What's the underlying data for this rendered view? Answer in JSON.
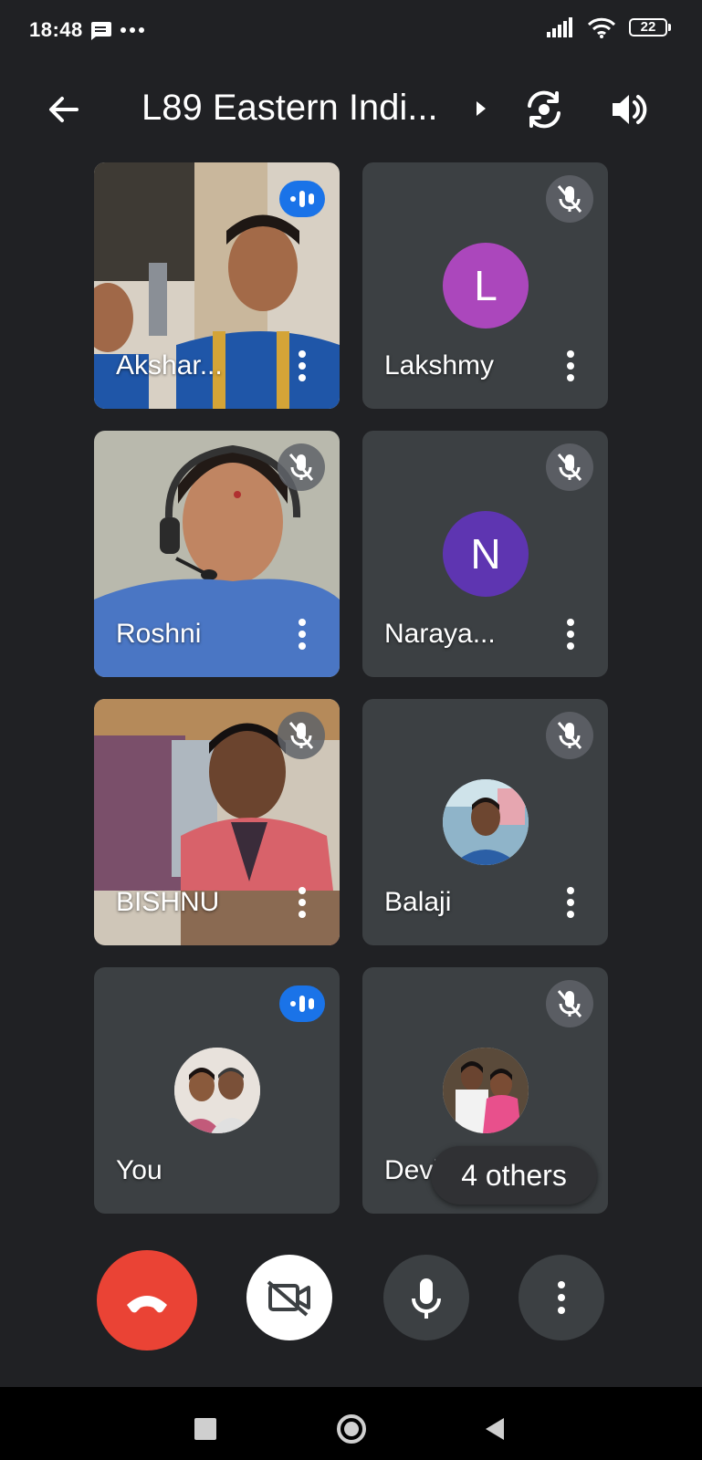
{
  "status_bar": {
    "time": "18:48",
    "battery": "22",
    "icons": [
      "message-icon",
      "more-icon",
      "signal-icon",
      "wifi-icon",
      "battery-icon"
    ]
  },
  "app_bar": {
    "title": "L89 Eastern Indi...",
    "icons": [
      "back-arrow-icon",
      "caret-right-icon",
      "switch-camera-icon",
      "speaker-icon"
    ]
  },
  "participants": [
    {
      "name": "Akshar...",
      "video": true,
      "status": "speaking"
    },
    {
      "name": "Lakshmy",
      "video": false,
      "initial": "L",
      "avatar_color": "#ab47bc",
      "status": "muted"
    },
    {
      "name": "Roshni",
      "video": true,
      "status": "muted"
    },
    {
      "name": "Naraya...",
      "video": false,
      "initial": "N",
      "avatar_color": "#5e35b1",
      "status": "muted"
    },
    {
      "name": "BISHNU",
      "video": true,
      "status": "muted"
    },
    {
      "name": "Balaji",
      "video": false,
      "status": "muted"
    },
    {
      "name": "You",
      "video": false,
      "status": "speaking"
    },
    {
      "name": "Devika",
      "video": false,
      "status": "muted"
    }
  ],
  "others_pill": "4 others",
  "colors": {
    "background": "#202124",
    "tile": "#3c4043",
    "end_call": "#ea4335",
    "speaking": "#1a73e8"
  }
}
